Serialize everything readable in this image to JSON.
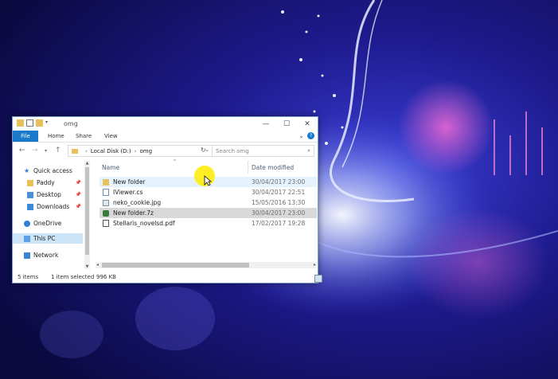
{
  "window": {
    "title": "omg",
    "ribbon_tabs": [
      "File",
      "Home",
      "Share",
      "View"
    ]
  },
  "address": {
    "path": [
      "Local Disk (D:)",
      "omg"
    ],
    "search_placeholder": "Search omg"
  },
  "nav": {
    "items": [
      {
        "label": "Quick access",
        "icon": "star-icon"
      },
      {
        "label": "Paddy",
        "icon": "folder-icon",
        "pinned": true
      },
      {
        "label": "Desktop",
        "icon": "desktop-folder-icon",
        "pinned": true
      },
      {
        "label": "Downloads",
        "icon": "downloads-folder-icon",
        "pinned": true
      },
      {
        "label": "OneDrive",
        "icon": "cloud-icon"
      },
      {
        "label": "This PC",
        "icon": "computer-icon",
        "selected": true
      },
      {
        "label": "Network",
        "icon": "network-icon"
      }
    ]
  },
  "list": {
    "columns": {
      "name": "Name",
      "date": "Date modified"
    },
    "rows": [
      {
        "name": "New folder",
        "date": "30/04/2017 23:00",
        "icon": "folder-icon",
        "state": "hover"
      },
      {
        "name": "IViewer.cs",
        "date": "30/04/2017 22:51",
        "icon": "cs-file-icon",
        "state": ""
      },
      {
        "name": "neko_cookie.jpg",
        "date": "15/05/2016 13:30",
        "icon": "image-file-icon",
        "state": ""
      },
      {
        "name": "New folder.7z",
        "date": "30/04/2017 23:00",
        "icon": "archive-file-icon",
        "state": "selected"
      },
      {
        "name": "Stellaris_novelsd.pdf",
        "date": "17/02/2017 19:28",
        "icon": "pdf-file-icon",
        "state": ""
      }
    ]
  },
  "status": {
    "count": "5 items",
    "selection": "1 item selected",
    "size": "996 KB"
  },
  "colors": {
    "accent": "#1979ca",
    "folder": "#e8c15a",
    "selected_row": "#d9d9d9",
    "hover_row": "#e5f3ff"
  }
}
